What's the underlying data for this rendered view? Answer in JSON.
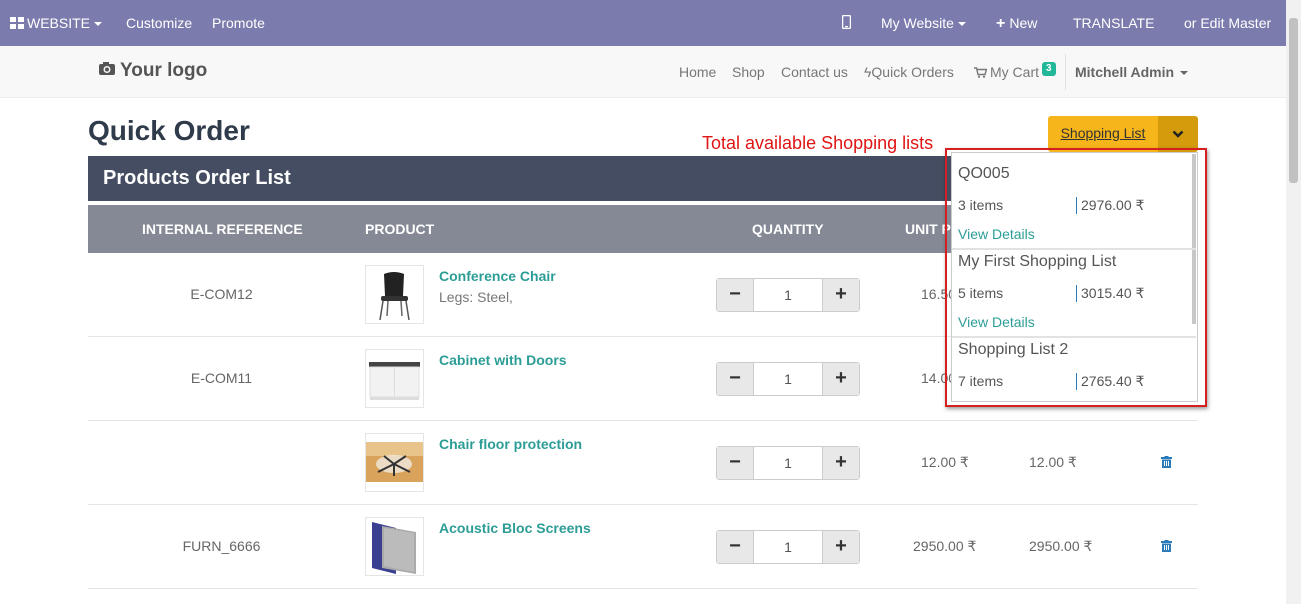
{
  "admin_bar": {
    "website_label": "WEBSITE",
    "customize_label": "Customize",
    "promote_label": "Promote",
    "my_website_label": "My Website",
    "new_label": "New",
    "translate_label": "TRANSLATE",
    "edit_master_label": "or Edit Master",
    "bg_color": "#7c7bad"
  },
  "navbar": {
    "logo_text": "Your logo",
    "links": [
      "Home",
      "Shop",
      "Contact us",
      "Quick Orders",
      "My Cart"
    ],
    "cart_count": "3",
    "user_name": "Mitchell Admin"
  },
  "page": {
    "title": "Quick Order",
    "shopping_list_button": "Shopping List",
    "annotation": "Total available Shopping lists"
  },
  "order_list": {
    "title": "Products Order List",
    "columns": [
      "INTERNAL REFERENCE",
      "PRODUCT",
      "QUANTITY",
      "UNIT P"
    ],
    "rows": [
      {
        "ref": "E-COM12",
        "name": "Conference Chair",
        "variant": "Legs: Steel,",
        "qty": "1",
        "unit_price": "16.50",
        "total_price": ""
      },
      {
        "ref": "E-COM11",
        "name": "Cabinet with Doors",
        "variant": "",
        "qty": "1",
        "unit_price": "14.00",
        "total_price": ""
      },
      {
        "ref": "",
        "name": "Chair floor protection",
        "variant": "",
        "qty": "1",
        "unit_price": "12.00 ₹",
        "total_price": "12.00 ₹"
      },
      {
        "ref": "FURN_6666",
        "name": "Acoustic Bloc Screens",
        "variant": "",
        "qty": "1",
        "unit_price": "2950.00 ₹",
        "total_price": "2950.00 ₹"
      }
    ]
  },
  "shopping_lists": [
    {
      "name": "QO005",
      "items": "3 items",
      "amount": "2976.00 ₹",
      "details": "View Details"
    },
    {
      "name": "My First Shopping List",
      "items": "5 items",
      "amount": "3015.40 ₹",
      "details": "View Details"
    },
    {
      "name": "Shopping List 2",
      "items": "7 items",
      "amount": "2765.40 ₹",
      "details": ""
    }
  ],
  "colors": {
    "accent": "#2c9d96",
    "button": "#f6b61b",
    "header_dark": "#454d62",
    "annotation_red": "#e01515"
  }
}
